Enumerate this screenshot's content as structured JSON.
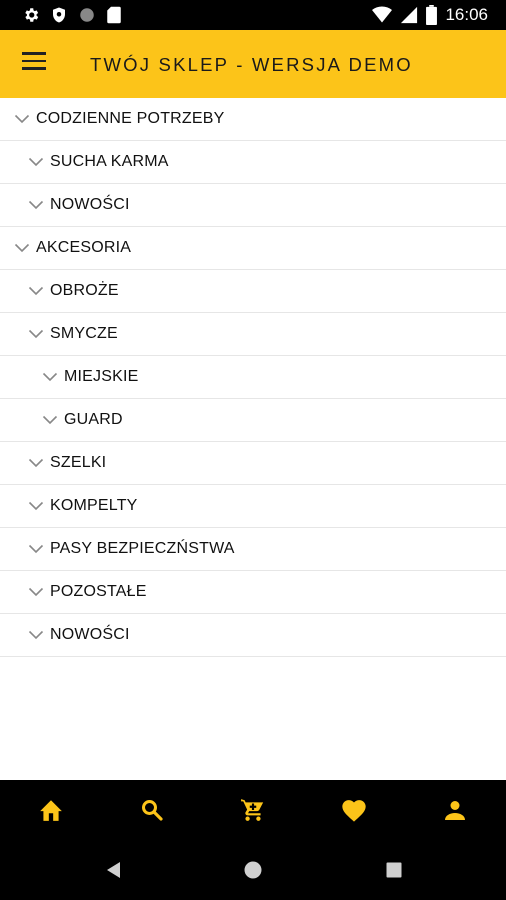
{
  "status_bar": {
    "time": "16:06",
    "icons_left": [
      "gear-icon",
      "shield-icon",
      "circle-icon",
      "sd-card-icon"
    ],
    "icons_right": [
      "wifi-icon",
      "signal-icon",
      "battery-icon"
    ]
  },
  "app_bar": {
    "title": "TWÓJ SKLEP - WERSJA DEMO",
    "color": "#fcc419"
  },
  "categories": [
    {
      "label": "CODZIENNE POTRZEBY",
      "level": 0
    },
    {
      "label": "SUCHA KARMA",
      "level": 1
    },
    {
      "label": "NOWOŚCI",
      "level": 1
    },
    {
      "label": "AKCESORIA",
      "level": 0
    },
    {
      "label": "OBROŻE",
      "level": 1
    },
    {
      "label": "SMYCZE",
      "level": 1
    },
    {
      "label": "MIEJSKIE",
      "level": 2
    },
    {
      "label": "GUARD",
      "level": 2
    },
    {
      "label": "SZELKI",
      "level": 1
    },
    {
      "label": "KOMPELTY",
      "level": 1
    },
    {
      "label": "PASY BEZPIECZŃSTWA",
      "level": 1
    },
    {
      "label": "POZOSTAŁE",
      "level": 1
    },
    {
      "label": "NOWOŚCI",
      "level": 1
    }
  ],
  "bottom_nav": {
    "items": [
      "home-icon",
      "search-icon",
      "cart-icon",
      "heart-icon",
      "person-icon"
    ],
    "icon_color": "#fcc419"
  },
  "system_nav": [
    "back-icon",
    "home-circle-icon",
    "recents-icon"
  ]
}
